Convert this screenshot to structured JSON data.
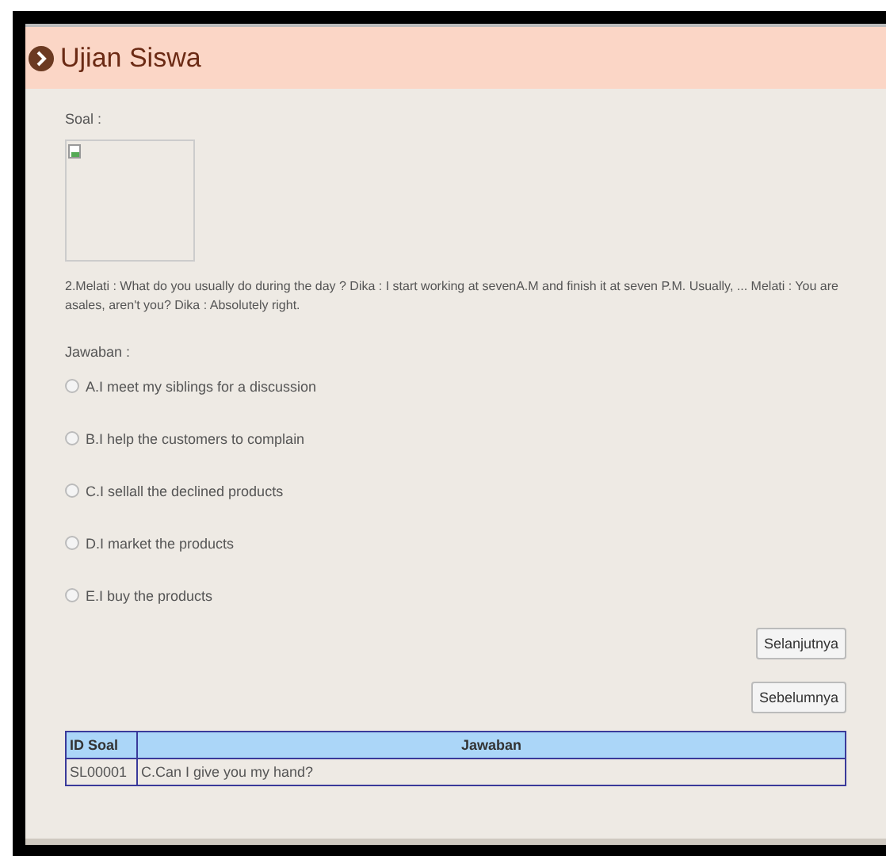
{
  "header": {
    "title": "Ujian Siswa"
  },
  "question": {
    "label": "Soal :",
    "image": {
      "kind": "broken-image"
    },
    "text": "2.Melati : What do you usually do during the day ? Dika : I start working at sevenA.M and finish it at seven P.M. Usually, ... Melati : You are asales, aren't you? Dika : Absolutely right."
  },
  "answers": {
    "label": "Jawaban :",
    "options": [
      {
        "label": "A.I meet my siblings for a discussion",
        "selected": false
      },
      {
        "label": "B.I help the customers to complain",
        "selected": false
      },
      {
        "label": "C.I sellall the declined products",
        "selected": false
      },
      {
        "label": "D.I market the products",
        "selected": false
      },
      {
        "label": "E.I buy the products",
        "selected": false
      }
    ]
  },
  "buttons": [
    "Selanjutnya",
    "Sebelumnya"
  ],
  "table": {
    "columns": [
      "ID Soal",
      "Jawaban"
    ],
    "rows": [
      [
        "SL00001",
        "C.Can I give you my hand?"
      ]
    ]
  }
}
